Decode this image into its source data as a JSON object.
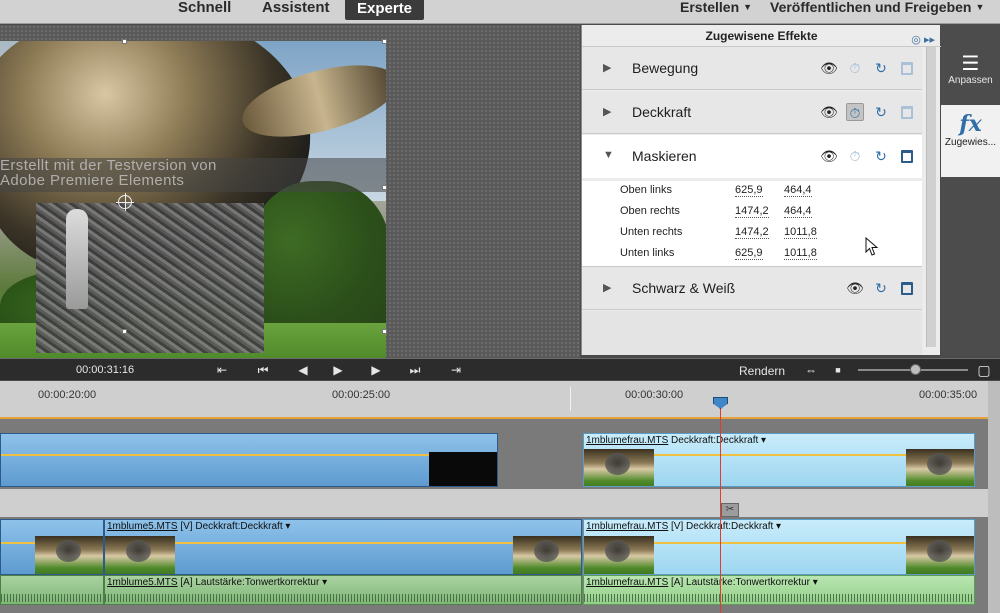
{
  "top_menu": {
    "modes": [
      "Schnell",
      "Assistent",
      "Experte"
    ],
    "active_mode": "Experte",
    "menus": [
      "Erstellen",
      "Veröffentlichen und Freigeben"
    ]
  },
  "monitor": {
    "watermark_line1": "Erstellt mit der Testversion von",
    "watermark_line2": "Adobe Premiere Elements"
  },
  "effects_panel": {
    "title": "Zugewisene Effekte",
    "effects": [
      {
        "name": "Bewegung",
        "expanded": false
      },
      {
        "name": "Deckkraft",
        "expanded": false
      },
      {
        "name": "Maskieren",
        "expanded": true
      },
      {
        "name": "Schwarz & Weiß",
        "expanded": false
      }
    ],
    "mask_params": [
      {
        "label": "Oben links",
        "x": "625,9",
        "y": "464,4"
      },
      {
        "label": "Oben rechts",
        "x": "1474,2",
        "y": "464,4"
      },
      {
        "label": "Unten rechts",
        "x": "1474,2",
        "y": "1011,8"
      },
      {
        "label": "Unten links",
        "x": "625,9",
        "y": "1011,8"
      }
    ]
  },
  "right_toolbar": {
    "adjust_label": "Anpassen",
    "applied_label": "Zugewies..."
  },
  "transport": {
    "timecode": "00:00:31:16",
    "render_label": "Rendern"
  },
  "timeline": {
    "ruler_labels": [
      "00:00:20:00",
      "00:00:25:00",
      "00:00:30:00",
      "00:00:35:00"
    ],
    "clips": {
      "top_right_title_file": "1mblumefrau.MTS",
      "top_right_title_rest": "Deckkraft:Deckkraft",
      "v_left_file": "1mblume5.MTS",
      "v_left_rest": "[V] Deckkraft:Deckkraft",
      "v_right_file": "1mblumefrau.MTS",
      "v_right_rest": "[V] Deckkraft:Deckkraft",
      "a_left_file": "1mblume5.MTS",
      "a_left_rest": "[A] Lautstärke:Tonwertkorrektur",
      "a_right_file": "1mblumefrau.MTS",
      "a_right_rest": "[A] Lautstärke:Tonwertkorrektur"
    }
  }
}
